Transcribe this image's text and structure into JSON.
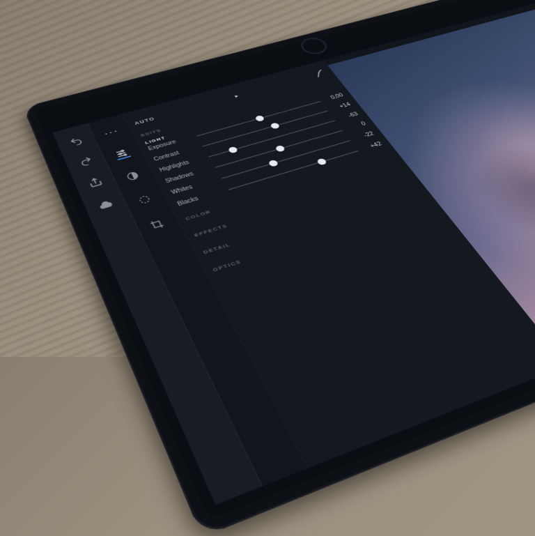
{
  "toolbar": {
    "items": [
      {
        "name": "undo-icon"
      },
      {
        "name": "redo-icon"
      },
      {
        "name": "share-icon"
      },
      {
        "name": "cloud-icon"
      }
    ]
  },
  "mode_strip": {
    "more_label": "···",
    "tabs": [
      {
        "name": "adjust-icon",
        "active": true
      },
      {
        "name": "contrast-circle-icon",
        "active": false
      },
      {
        "name": "color-wheel-icon",
        "active": false
      },
      {
        "name": "crop-icon",
        "active": false
      }
    ]
  },
  "panel": {
    "auto_label": "AUTO",
    "edits_label": "EDITS",
    "sections": [
      {
        "key": "light",
        "label": "LIGHT",
        "active": true
      },
      {
        "key": "color",
        "label": "COLOR",
        "active": false
      },
      {
        "key": "effects",
        "label": "EFFECTS",
        "active": false
      },
      {
        "key": "detail",
        "label": "DETAIL",
        "active": false
      },
      {
        "key": "optics",
        "label": "OPTICS",
        "active": false
      }
    ],
    "sliders": [
      {
        "key": "exposure",
        "label": "Exposure",
        "value_display": "0,00",
        "fraction": 0.5
      },
      {
        "key": "contrast",
        "label": "Contrast",
        "value_display": "+14",
        "fraction": 0.57
      },
      {
        "key": "highlights",
        "label": "Highlights",
        "value_display": "-63",
        "fraction": 0.185
      },
      {
        "key": "shadows",
        "label": "Shadows",
        "value_display": "0",
        "fraction": 0.5
      },
      {
        "key": "whites",
        "label": "Whites",
        "value_display": "-22",
        "fraction": 0.39
      },
      {
        "key": "blacks",
        "label": "Blacks",
        "value_display": "+42",
        "fraction": 0.71
      }
    ]
  }
}
